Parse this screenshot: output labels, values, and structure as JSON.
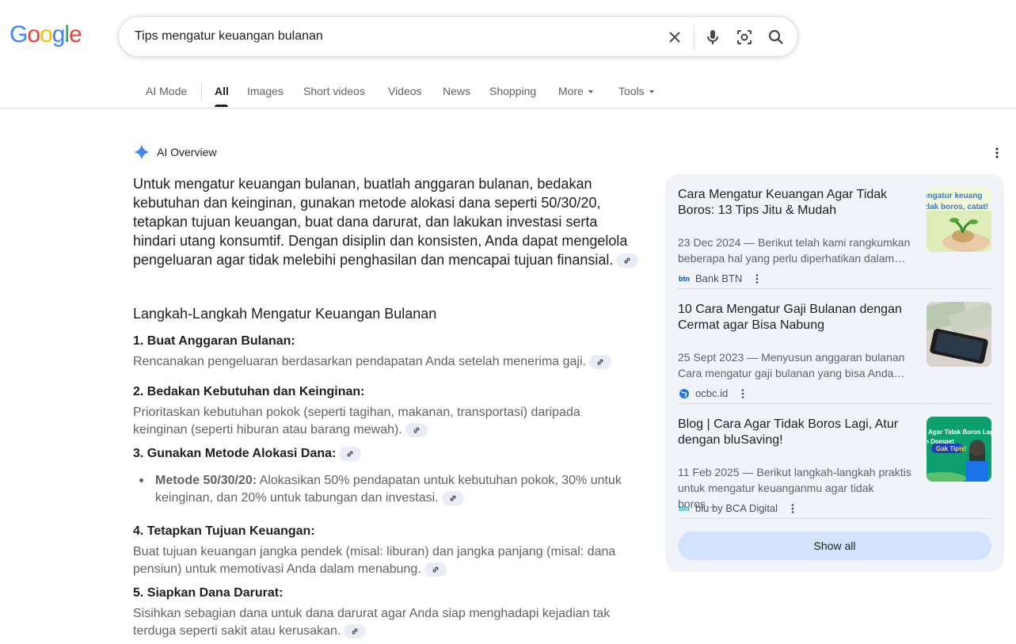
{
  "logo": {
    "letters": [
      "G",
      "o",
      "o",
      "g",
      "l",
      "e"
    ],
    "colors": [
      "#4285f4",
      "#ea4335",
      "#fbbc05",
      "#4285f4",
      "#34a853",
      "#ea4335"
    ]
  },
  "search": {
    "query": "Tips mengatur keuangan bulanan"
  },
  "tabs": [
    {
      "label": "AI Mode"
    },
    {
      "label": "All"
    },
    {
      "label": "Images"
    },
    {
      "label": "Short videos"
    },
    {
      "label": "Videos"
    },
    {
      "label": "News"
    },
    {
      "label": "Shopping"
    },
    {
      "label": "More"
    },
    {
      "label": "Tools"
    }
  ],
  "overview": {
    "title": "AI Overview",
    "summary": "Untuk mengatur keuangan bulanan, buatlah anggaran bulanan, bedakan kebutuhan dan keinginan, gunakan metode alokasi dana seperti 50/30/20, tetapkan tujuan keuangan, buat dana darurat, dan lakukan investasi serta hindari utang konsumtif. Dengan disiplin dan konsisten, Anda dapat mengelola pengeluaran agar tidak melebihi penghasilan dan mencapai tujuan finansial.",
    "heading": "Langkah-Langkah Mengatur Keuangan Bulanan",
    "steps": [
      {
        "title": "1. Buat Anggaran Bulanan:",
        "body": "Rencanakan pengeluaran berdasarkan pendapatan Anda setelah menerima gaji."
      },
      {
        "title": "2. Bedakan Kebutuhan dan Keinginan:",
        "body": "Prioritaskan kebutuhan pokok (seperti tagihan, makanan, transportasi) daripada keinginan (seperti hiburan atau barang mewah)."
      },
      {
        "title": "3. Gunakan Metode Alokasi Dana:",
        "body": ""
      },
      {
        "title": "4. Tetapkan Tujuan Keuangan:",
        "body": "Buat tujuan keuangan jangka pendek (misal: liburan) dan jangka panjang (misal: dana pensiun) untuk memotivasi Anda dalam menabung."
      },
      {
        "title": "5. Siapkan Dana Darurat:",
        "body": "Sisihkan sebagian dana untuk dana darurat agar Anda siap menghadapi kejadian tak terduga seperti sakit atau kerusakan."
      }
    ],
    "bullet": {
      "label": "Metode 50/30/20:",
      "text": "Alokasikan 50% pendapatan untuk kebutuhan pokok, 30% untuk keinginan, dan 20% untuk tabungan dan investasi."
    }
  },
  "sources": [
    {
      "title": "Cara Mengatur Keuangan Agar Tidak Boros: 13 Tips Jitu & Mudah",
      "snippet": "23 Dec 2024 — Berikut telah kami rangkumkan beberapa hal yang perlu diperhatikan dalam…",
      "site": "Bank BTN",
      "favicon": "btn",
      "thumb_text": "engatur keuang dak boros, catat!"
    },
    {
      "title": "10 Cara Mengatur Gaji Bulanan dengan Cermat agar Bisa Nabung",
      "snippet": "25 Sept 2023 — Menyusun anggaran bulanan Cara mengatur gaji bulanan yang bisa Anda…",
      "site": "ocbc.id",
      "favicon": "globe",
      "thumb_text": ""
    },
    {
      "title": "Blog | Cara Agar Tidak Boros Lagi, Atur dengan bluSaving!",
      "snippet": "11 Feb 2025 — Berikut langkah-langkah praktis untuk mengatur keuanganmu agar tidak boros…",
      "site": "blu by BCA Digital",
      "favicon": "blu",
      "thumb_text": "Agar Tidak Boros Lag n Dompet Gak Tipis!"
    }
  ],
  "show_all": "Show all"
}
